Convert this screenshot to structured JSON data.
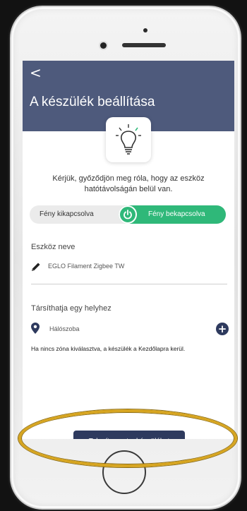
{
  "screen": {
    "back_label": "<",
    "title": "A készülék beállítása",
    "description": "Kérjük, győződjön meg róla, hogy az eszköz hatótávolságán belül van.",
    "toggle": {
      "off_label": "Fény kikapcsolva",
      "on_label": "Fény bekapcsolva",
      "state": "on"
    },
    "device_name_label": "Eszköz neve",
    "device_name_value": "EGLO Filament Zigbee TW",
    "place_label": "Társíthatja egy helyhez",
    "place_value": "Hálószoba",
    "note": "Ha nincs zóna kiválasztva, a készülék a Kezdőlapra kerül.",
    "install_button": "Telepítse ezt a készüléket"
  },
  "icons": {
    "bulb": "lightbulb-icon",
    "power": "power-icon",
    "edit": "pencil-icon",
    "pin": "location-pin-icon",
    "add": "plus-circle-icon"
  },
  "colors": {
    "header": "#4e5a7c",
    "toggle_on": "#2fb879",
    "primary_button": "#2e3a5e",
    "highlight": "#d7a520"
  }
}
